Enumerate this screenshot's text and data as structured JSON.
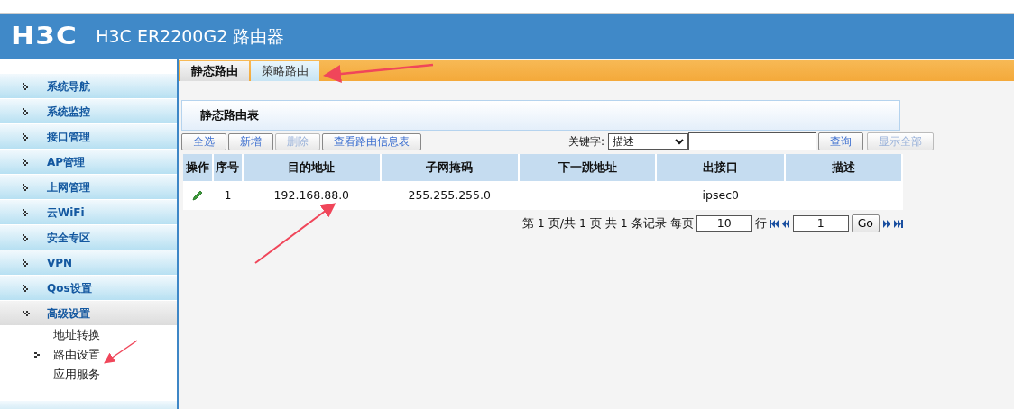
{
  "header": {
    "logo": "H3C",
    "title": "H3C ER2200G2 路由器"
  },
  "sidebar": {
    "items": [
      {
        "label": "系统导航",
        "expanded": false
      },
      {
        "label": "系统监控",
        "expanded": false
      },
      {
        "label": "接口管理",
        "expanded": false
      },
      {
        "label": "AP管理",
        "expanded": false
      },
      {
        "label": "上网管理",
        "expanded": false
      },
      {
        "label": "云WiFi",
        "expanded": false
      },
      {
        "label": "安全专区",
        "expanded": false
      },
      {
        "label": "VPN",
        "expanded": false
      },
      {
        "label": "Qos设置",
        "expanded": false
      },
      {
        "label": "高级设置",
        "expanded": true,
        "children": [
          {
            "label": "地址转换",
            "selected": false
          },
          {
            "label": "路由设置",
            "selected": true
          },
          {
            "label": "应用服务",
            "selected": false
          }
        ]
      }
    ]
  },
  "tabs": [
    {
      "label": "静态路由",
      "selected": true
    },
    {
      "label": "策略路由",
      "selected": false
    }
  ],
  "panel": {
    "title": "静态路由表"
  },
  "toolbar": [
    {
      "label": "全选",
      "disabled": false
    },
    {
      "label": "新增",
      "disabled": false
    },
    {
      "label": "删除",
      "disabled": true
    },
    {
      "label": "查看路由信息表",
      "disabled": false
    }
  ],
  "search": {
    "label": "关键字:",
    "select_value": "描述",
    "buttons": [
      {
        "label": "查询",
        "disabled": false
      },
      {
        "label": "显示全部",
        "disabled": true
      }
    ]
  },
  "table": {
    "columns": [
      "操作",
      "序号",
      "目的地址",
      "子网掩码",
      "下一跳地址",
      "出接口",
      "描述"
    ],
    "rows": [
      {
        "number": "1",
        "destination": "192.168.88.0",
        "mask": "255.255.255.0",
        "interface": "ipsec0"
      }
    ]
  },
  "pagination": {
    "summary": "第 1 页/共 1 页 共 1 条记录 每页",
    "per_page": "10",
    "rows_unit": "行",
    "page": "1",
    "go": "Go"
  }
}
